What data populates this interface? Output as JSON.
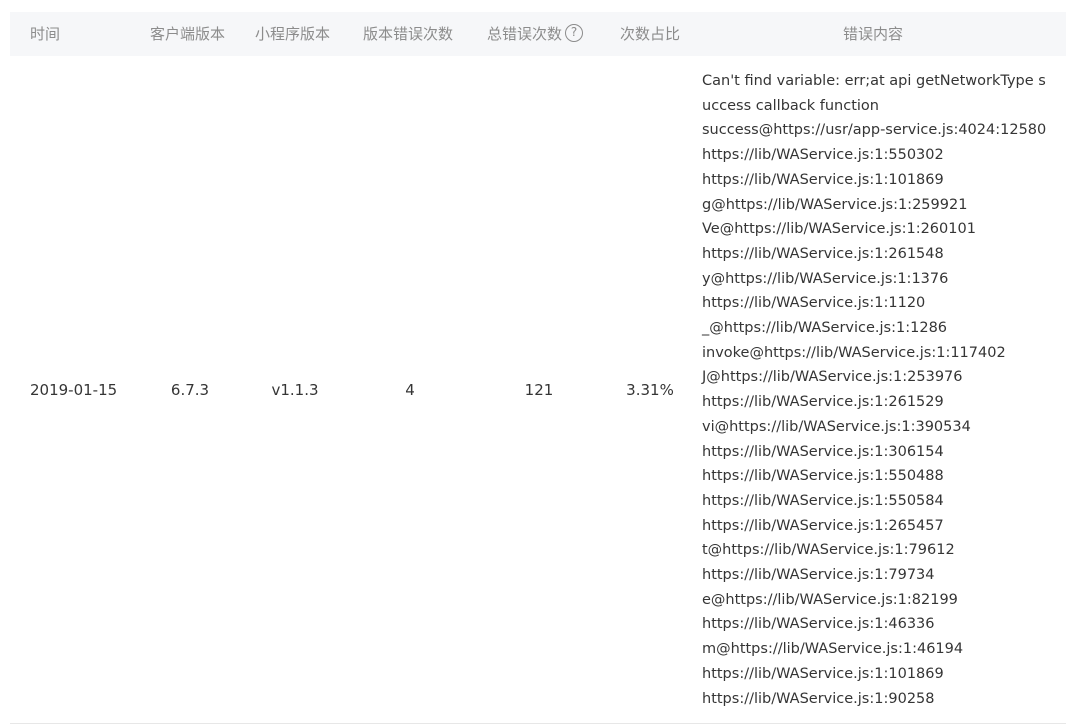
{
  "table": {
    "headers": {
      "time": "时间",
      "client_version": "客户端版本",
      "miniprogram_version": "小程序版本",
      "version_error_count": "版本错误次数",
      "total_error_count": "总错误次数",
      "count_ratio": "次数占比",
      "error_content": "错误内容"
    },
    "help_icon_glyph": "?",
    "row": {
      "time": "2019-01-15",
      "client_version": "6.7.3",
      "miniprogram_version": "v1.1.3",
      "version_error_count": "4",
      "total_error_count": "121",
      "count_ratio": "3.31%",
      "error_lines": [
        "Can't find variable: err;at api getNetworkType success callback function",
        "success@https://usr/app-service.js:4024:12580",
        "https://lib/WAService.js:1:550302",
        "https://lib/WAService.js:1:101869",
        "g@https://lib/WAService.js:1:259921",
        "Ve@https://lib/WAService.js:1:260101",
        "https://lib/WAService.js:1:261548",
        "y@https://lib/WAService.js:1:1376",
        "https://lib/WAService.js:1:1120",
        "_@https://lib/WAService.js:1:1286",
        "invoke@https://lib/WAService.js:1:117402",
        "J@https://lib/WAService.js:1:253976",
        "https://lib/WAService.js:1:261529",
        "vi@https://lib/WAService.js:1:390534",
        "https://lib/WAService.js:1:306154",
        "https://lib/WAService.js:1:550488",
        "https://lib/WAService.js:1:550584",
        "https://lib/WAService.js:1:265457",
        "t@https://lib/WAService.js:1:79612",
        "https://lib/WAService.js:1:79734",
        "e@https://lib/WAService.js:1:82199",
        "https://lib/WAService.js:1:46336",
        "m@https://lib/WAService.js:1:46194",
        "https://lib/WAService.js:1:101869",
        "https://lib/WAService.js:1:90258"
      ]
    }
  }
}
